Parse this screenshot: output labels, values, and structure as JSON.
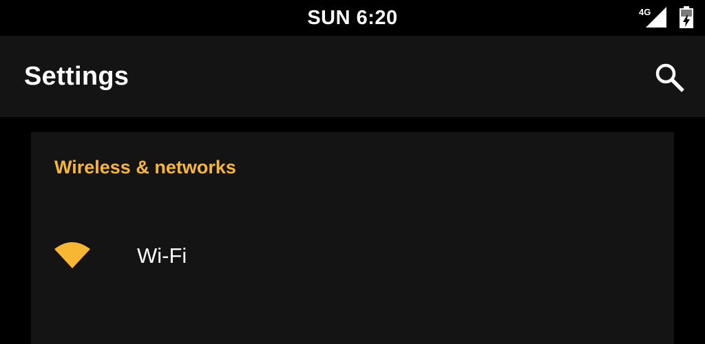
{
  "status_bar": {
    "time": "SUN 6:20",
    "network_type": "4G",
    "icons": [
      "signal-icon",
      "battery-icon"
    ]
  },
  "app_bar": {
    "title": "Settings",
    "search_icon": "search-icon"
  },
  "sections": [
    {
      "header": "Wireless & networks",
      "items": [
        {
          "label": "Wi-Fi",
          "icon": "wifi-icon"
        }
      ]
    }
  ],
  "colors": {
    "accent": "#f7b733",
    "background": "#000000",
    "surface": "#141414",
    "text": "#ffffff"
  }
}
